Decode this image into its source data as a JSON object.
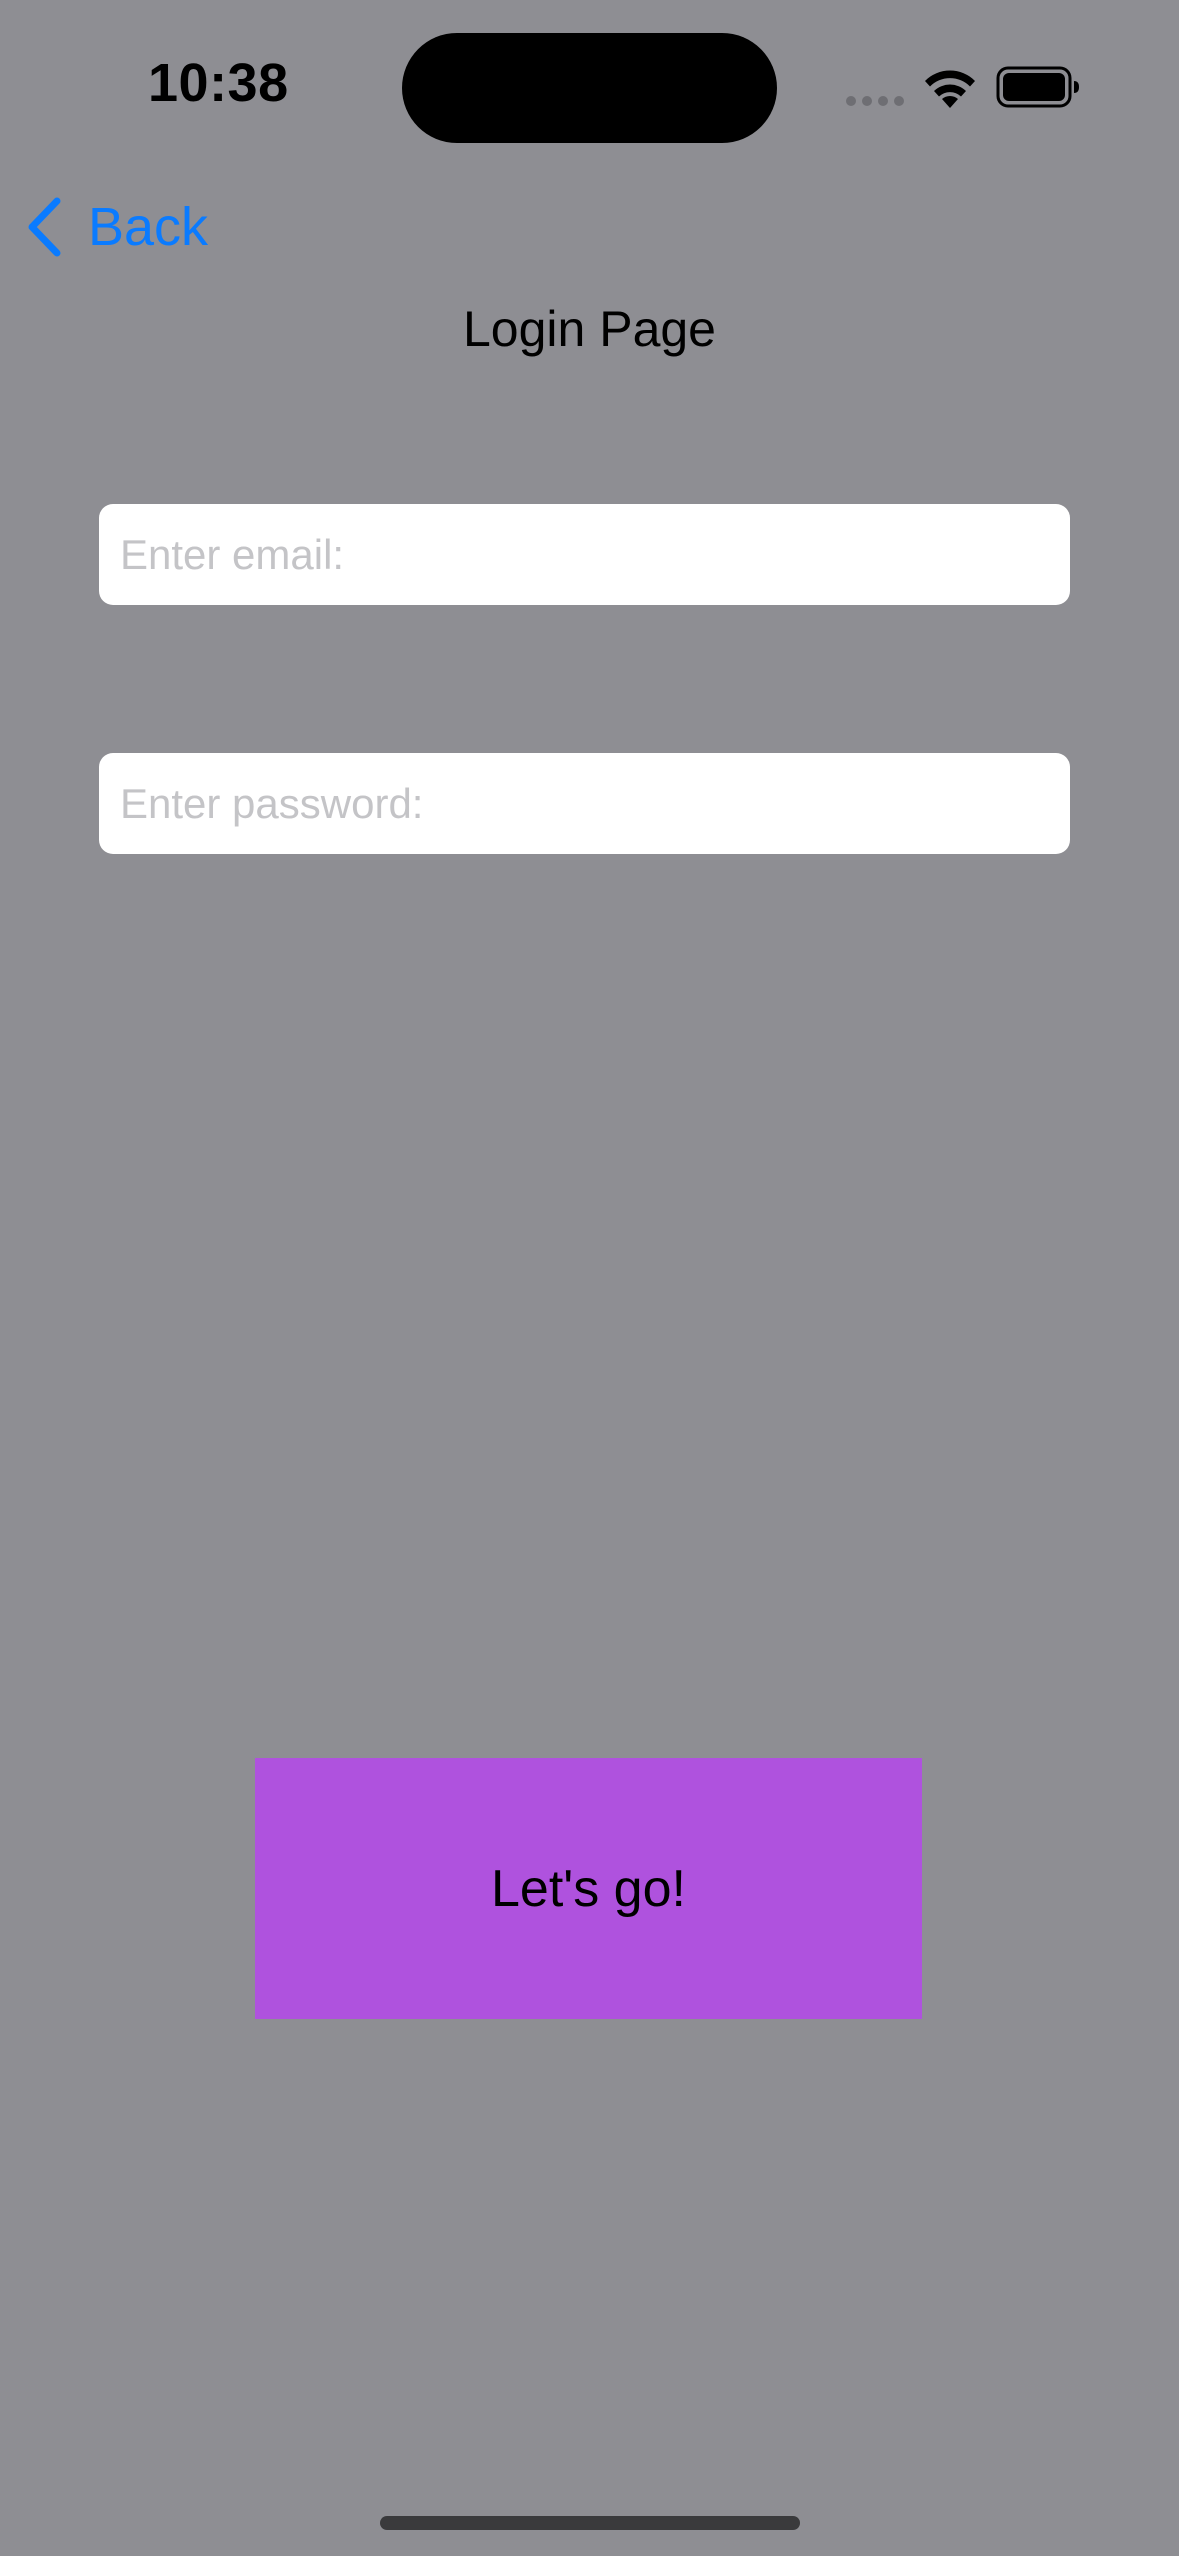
{
  "status_bar": {
    "time": "10:38"
  },
  "nav": {
    "back_label": "Back",
    "back_icon": "chevron-left-icon",
    "title": "Login Page"
  },
  "form": {
    "email_placeholder": "Enter email:",
    "email_value": "",
    "password_placeholder": "Enter password:",
    "password_value": ""
  },
  "action": {
    "submit_label": "Let's go!"
  },
  "colors": {
    "background": "#8e8e93",
    "accent": "#0a7bff",
    "button": "#af52de"
  }
}
